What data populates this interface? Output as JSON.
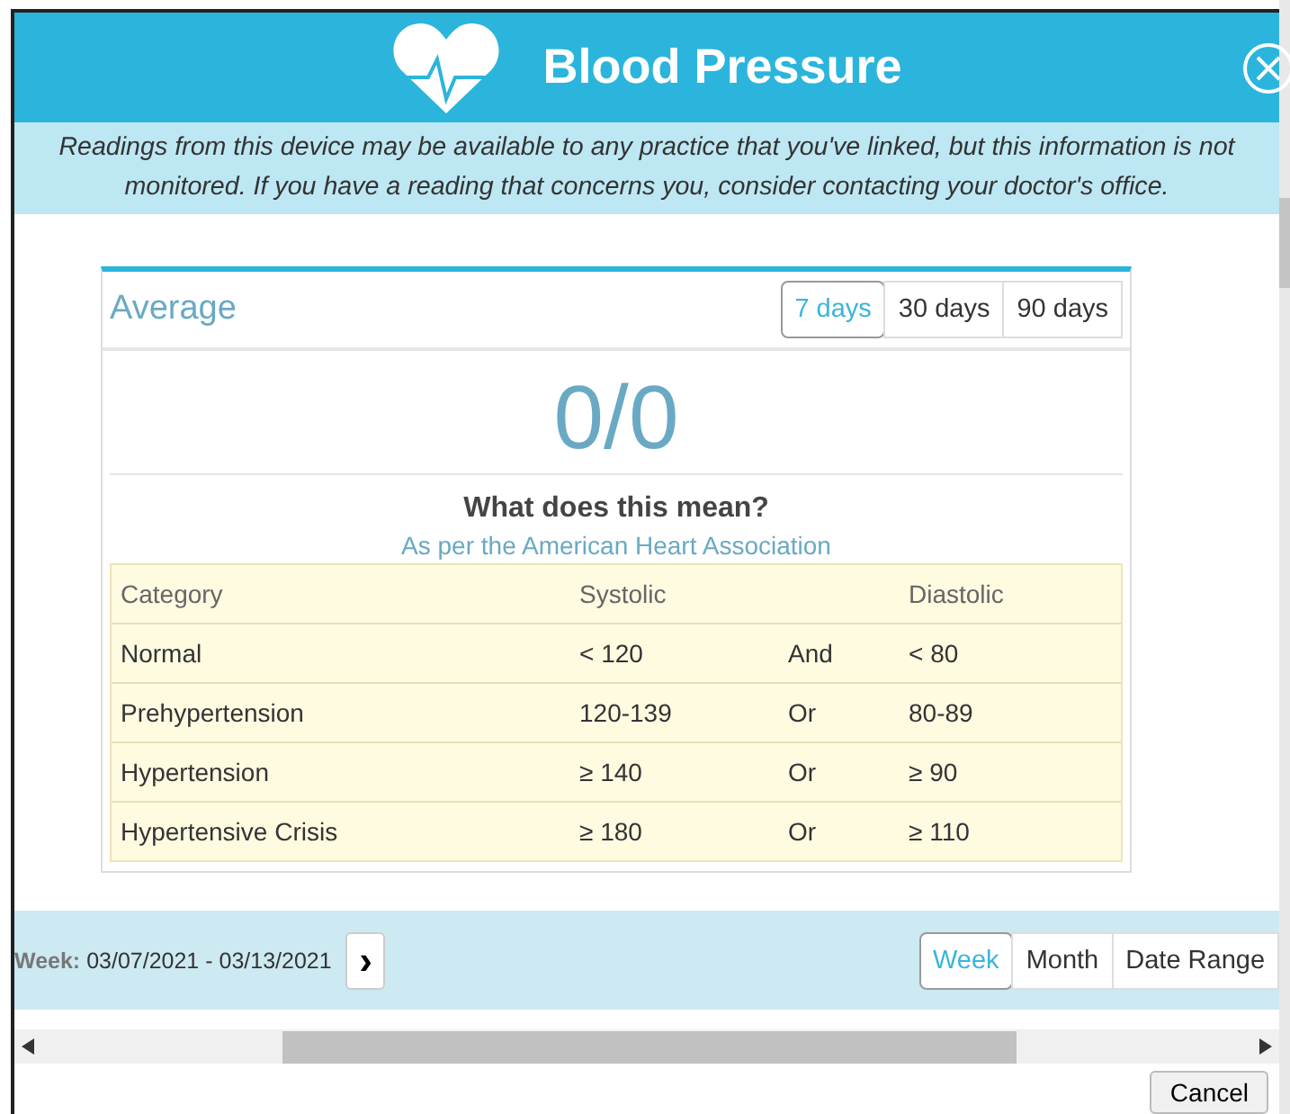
{
  "header": {
    "title": "Blood Pressure"
  },
  "notice": "Readings from this device may be available to any practice that you've linked, but this information is not monitored. If you have a reading that concerns you, consider contacting your doctor's office.",
  "average": {
    "title": "Average",
    "ranges": [
      {
        "label": "7 days",
        "selected": true
      },
      {
        "label": "30 days",
        "selected": false
      },
      {
        "label": "90 days",
        "selected": false
      }
    ],
    "value": "0/0",
    "question": "What does this mean?",
    "source": "As per the American Heart Association"
  },
  "table": {
    "columns": [
      "Category",
      "Systolic",
      "",
      "Diastolic"
    ],
    "rows": [
      [
        "Normal",
        "< 120",
        "And",
        "< 80"
      ],
      [
        "Prehypertension",
        "120-139",
        "Or",
        "80-89"
      ],
      [
        "Hypertension",
        "≥ 140",
        "Or",
        "≥ 90"
      ],
      [
        "Hypertensive Crisis",
        "≥ 180",
        "Or",
        "≥ 110"
      ]
    ]
  },
  "period": {
    "label": "Week:",
    "dates": "03/07/2021 - 03/13/2021",
    "next": "›",
    "views": [
      {
        "label": "Week",
        "selected": true
      },
      {
        "label": "Month",
        "selected": false
      },
      {
        "label": "Date Range",
        "selected": false
      }
    ]
  },
  "buttons": [
    "Cancel"
  ]
}
